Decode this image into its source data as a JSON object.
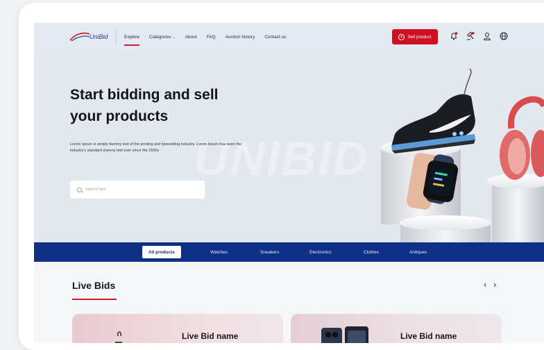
{
  "nav": {
    "logo_text": "UniBid",
    "links": [
      {
        "label": "Explore"
      },
      {
        "label": "Categories"
      },
      {
        "label": "About"
      },
      {
        "label": "FAQ"
      },
      {
        "label": "Auction history"
      },
      {
        "label": "Contact us"
      }
    ],
    "sell_button": "Sell product"
  },
  "hero": {
    "title_line1": "Start bidding and sell",
    "title_line2": "your products",
    "description": "Lorem Ipsum is simply dummy text of the printing and typesetting industry. Lorem Ipsum has been the industry's standard dummy text ever since the 1500s",
    "search_placeholder": "Search here",
    "watermark": "UNIBID"
  },
  "categories": [
    {
      "label": "All products",
      "active": true
    },
    {
      "label": "Watches"
    },
    {
      "label": "Sneakers"
    },
    {
      "label": "Electronics"
    },
    {
      "label": "Clothes"
    },
    {
      "label": "Antiques"
    }
  ],
  "live_bids": {
    "title": "Live Bids",
    "prev_arrow": "‹",
    "next_arrow": "›",
    "cards": [
      {
        "name": "Live Bid name"
      },
      {
        "name": "Live Bid name"
      }
    ]
  },
  "colors": {
    "accent_red": "#d0101f",
    "navy": "#0d2f86",
    "hero_bg": "#e3e7ee"
  }
}
